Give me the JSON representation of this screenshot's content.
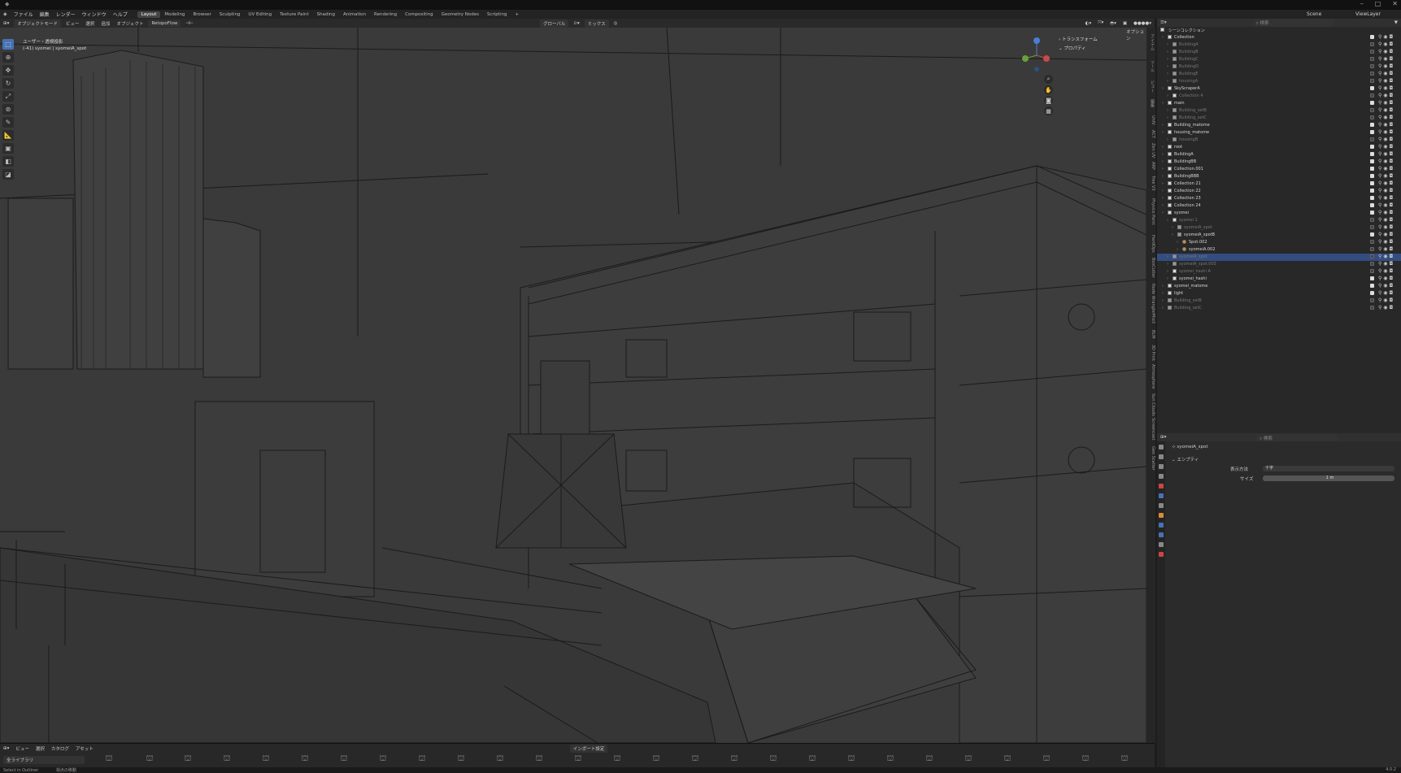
{
  "window": {
    "controls": [
      "–",
      "□",
      "✕"
    ]
  },
  "menu": [
    "ファイル",
    "編集",
    "レンダー",
    "ウィンドウ",
    "ヘルプ"
  ],
  "workspaces": [
    "Layout",
    "Modeling",
    "Browser",
    "Sculpting",
    "UV Editing",
    "Texture Paint",
    "Shading",
    "Animation",
    "Rendering",
    "Compositing",
    "Geometry Nodes",
    "Scripting",
    "+"
  ],
  "scene": {
    "label": "Scene",
    "viewlayer": "ViewLayer"
  },
  "header": {
    "mode": "オブジェクトモード",
    "view": "ビュー",
    "select": "選択",
    "add": "追加",
    "object": "オブジェクト",
    "retopo": "RetopoFlow",
    "transform": "グローバル",
    "snap": "ミックス"
  },
  "viewport": {
    "info_line1": "ユーザー・透視投影",
    "info_line2": "(-41) syomei | syomeiA_spot",
    "options": "オプション",
    "npanel": [
      "トランスフォーム",
      "プロパティ"
    ]
  },
  "gizmo": {
    "x": "X",
    "y": "Y",
    "z": "Z"
  },
  "vtabs": [
    "アイテム",
    "ツール",
    "ビュー",
    "編集",
    "UnIV",
    "ACT",
    "Zen UV",
    "ARP",
    "Tree V3",
    "Physics Paint",
    "HardOps",
    "BoxCutter",
    "Node Wrangler",
    "Mio3",
    "BLM",
    "3D Print",
    "Atmosphere",
    "Sun Clouds",
    "Screencast",
    "Geo Scatter"
  ],
  "bottom": {
    "view": "ビュー",
    "select": "選択",
    "catalog": "カタログ",
    "asset": "アセット",
    "import": "インポート設定",
    "library": "全ライブラリ"
  },
  "status": {
    "left": "Select in Outliner",
    "mid": "視点の移動",
    "right": "4.0.2"
  },
  "outliner": {
    "search_placeholder": "検索",
    "root": "シーンコレクション",
    "rows": [
      {
        "label": "Collection",
        "indent": 0,
        "kind": "coll",
        "dim": false,
        "chk": true
      },
      {
        "label": "BuildingA",
        "indent": 1,
        "kind": "obj",
        "dim": true,
        "chk": false
      },
      {
        "label": "BuildingB",
        "indent": 1,
        "kind": "obj",
        "dim": true,
        "chk": false
      },
      {
        "label": "BuildingC",
        "indent": 1,
        "kind": "obj",
        "dim": true,
        "chk": false
      },
      {
        "label": "BuildingD",
        "indent": 1,
        "kind": "obj",
        "dim": true,
        "chk": false
      },
      {
        "label": "BuildingE",
        "indent": 1,
        "kind": "obj",
        "dim": true,
        "chk": false
      },
      {
        "label": "housingA",
        "indent": 1,
        "kind": "obj",
        "dim": true,
        "chk": false
      },
      {
        "label": "SkyScraperA",
        "indent": 0,
        "kind": "coll",
        "dim": false,
        "chk": true
      },
      {
        "label": "Collection 4",
        "indent": 1,
        "kind": "coll",
        "dim": true,
        "chk": false
      },
      {
        "label": "main",
        "indent": 0,
        "kind": "coll",
        "dim": false,
        "chk": true
      },
      {
        "label": "Building_setB",
        "indent": 1,
        "kind": "obj",
        "dim": true,
        "chk": false
      },
      {
        "label": "Building_setC",
        "indent": 1,
        "kind": "obj",
        "dim": true,
        "chk": false
      },
      {
        "label": "Building_matome",
        "indent": 0,
        "kind": "coll",
        "dim": false,
        "chk": true
      },
      {
        "label": "housing_matome",
        "indent": 0,
        "kind": "coll",
        "dim": false,
        "chk": true
      },
      {
        "label": "housingB",
        "indent": 1,
        "kind": "obj",
        "dim": true,
        "chk": false
      },
      {
        "label": "root",
        "indent": 0,
        "kind": "coll",
        "dim": false,
        "chk": true
      },
      {
        "label": "BuildingA",
        "indent": 0,
        "kind": "coll",
        "dim": false,
        "chk": true
      },
      {
        "label": "BuildingBB",
        "indent": 0,
        "kind": "coll",
        "dim": false,
        "chk": true
      },
      {
        "label": "Collection.001",
        "indent": 0,
        "kind": "coll",
        "dim": false,
        "chk": true
      },
      {
        "label": "BuildingBBB",
        "indent": 0,
        "kind": "coll",
        "dim": false,
        "chk": true
      },
      {
        "label": "Collection 21",
        "indent": 0,
        "kind": "coll",
        "dim": false,
        "chk": true
      },
      {
        "label": "Collection 22",
        "indent": 0,
        "kind": "coll",
        "dim": false,
        "chk": true
      },
      {
        "label": "Collection 23",
        "indent": 0,
        "kind": "coll",
        "dim": false,
        "chk": true
      },
      {
        "label": "Collection 24",
        "indent": 0,
        "kind": "coll",
        "dim": false,
        "chk": true
      },
      {
        "label": "syomei",
        "indent": 0,
        "kind": "coll",
        "dim": false,
        "chk": true
      },
      {
        "label": "syomei 1",
        "indent": 1,
        "kind": "coll",
        "dim": true,
        "chk": false
      },
      {
        "label": "syomeiA_spot",
        "indent": 2,
        "kind": "obj",
        "dim": true,
        "chk": false
      },
      {
        "label": "syomeiA_spotB",
        "indent": 2,
        "kind": "obj",
        "dim": false,
        "chk": true
      },
      {
        "label": "Spot.002",
        "indent": 3,
        "kind": "light",
        "dim": false,
        "chk": false
      },
      {
        "label": "syomeiA.002",
        "indent": 3,
        "kind": "light",
        "dim": false,
        "chk": false
      },
      {
        "label": "syomeiA_spot",
        "indent": 1,
        "kind": "obj",
        "dim": true,
        "chk": false,
        "sel": true
      },
      {
        "label": "syomeiA_spot.003",
        "indent": 1,
        "kind": "obj",
        "dim": true,
        "chk": false
      },
      {
        "label": "syomei_hashi A",
        "indent": 1,
        "kind": "coll",
        "dim": true,
        "chk": false
      },
      {
        "label": "syomei_hashi",
        "indent": 1,
        "kind": "coll",
        "dim": false,
        "chk": true
      },
      {
        "label": "syomei_matome",
        "indent": 0,
        "kind": "coll",
        "dim": false,
        "chk": true
      },
      {
        "label": "light",
        "indent": 0,
        "kind": "coll",
        "dim": false,
        "chk": true
      },
      {
        "label": "Building_setB",
        "indent": 0,
        "kind": "obj",
        "dim": true,
        "chk": false
      },
      {
        "label": "Building_setC",
        "indent": 0,
        "kind": "obj",
        "dim": true,
        "chk": false
      }
    ]
  },
  "properties": {
    "search_placeholder": "検索",
    "object_name": "syomeiA_spot",
    "section": "エンプティ",
    "display_label": "表示方法",
    "display_value": "十字",
    "size_label": "サイズ",
    "size_value": "1 m"
  },
  "colors": {
    "accent": "#4772b3",
    "selected_row": "#334d80",
    "orange_icon": "#d88b3a",
    "viewport_bg": "#3a3a3a"
  }
}
